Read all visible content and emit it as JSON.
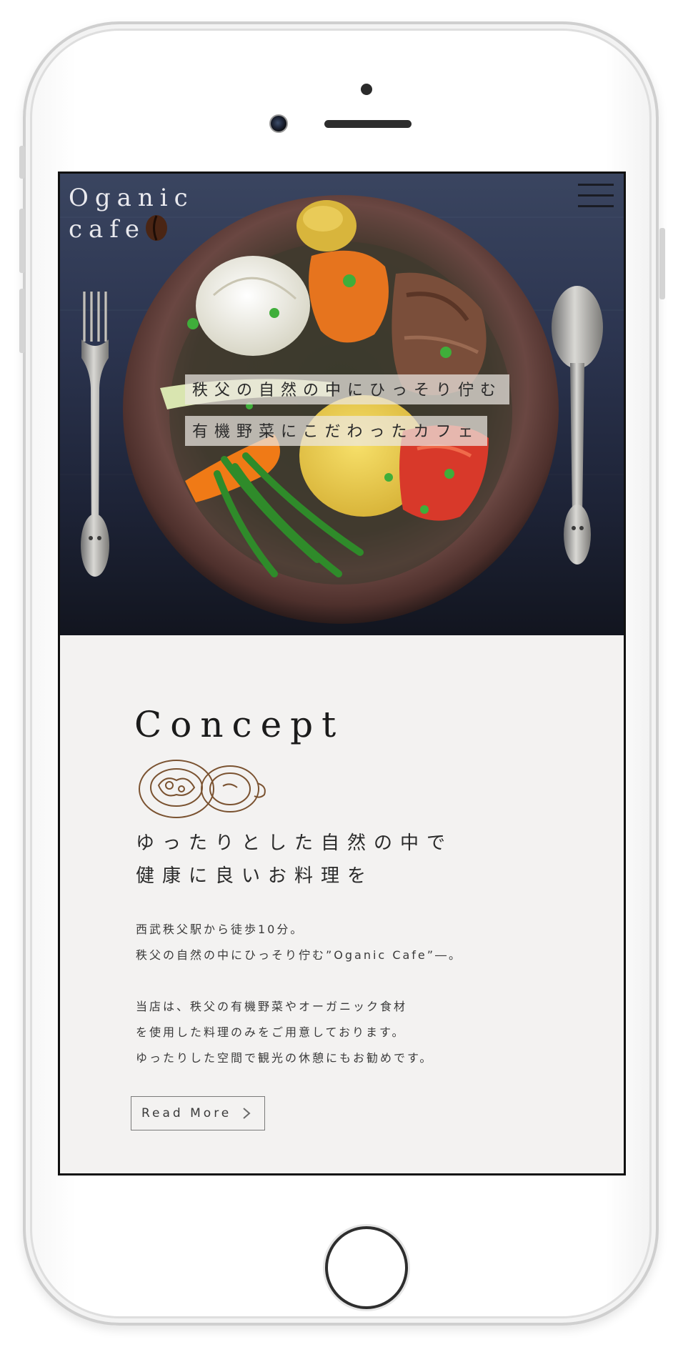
{
  "hero": {
    "logo_line1": "Oganic",
    "logo_line2": "cafe",
    "tagline_line1": "秩父の自然の中にひっそり佇む",
    "tagline_line2": "有機野菜にこだわったカフェ"
  },
  "concept": {
    "title": "Concept",
    "heading_lines": [
      "ゆったりとした自然の中で",
      "健康に良いお料理を"
    ],
    "body_paragraph1": [
      "西武秩父駅から徒歩10分。",
      "秩父の自然の中にひっそり佇む”Oganic Cafe”―。"
    ],
    "body_paragraph2": [
      "当店は、秩父の有機野菜やオーガニック食材",
      "を使用した料理のみをご用意しております。",
      "ゆったりした空間で観光の休憩にもお勧めです。"
    ],
    "read_more_label": "Read More"
  },
  "icons": {
    "menu": "hamburger-menu-icon",
    "logo_mark": "coffee-bean-icon",
    "illustration": "dish-and-cup-illustration",
    "read_more_arrow": "chevron-right-icon"
  },
  "colors": {
    "hero_table": "#2c3550",
    "plate": "#5b3a35",
    "section_bg": "#f3f2f1",
    "bean": "#4a2514",
    "text": "#2a2a2a"
  }
}
